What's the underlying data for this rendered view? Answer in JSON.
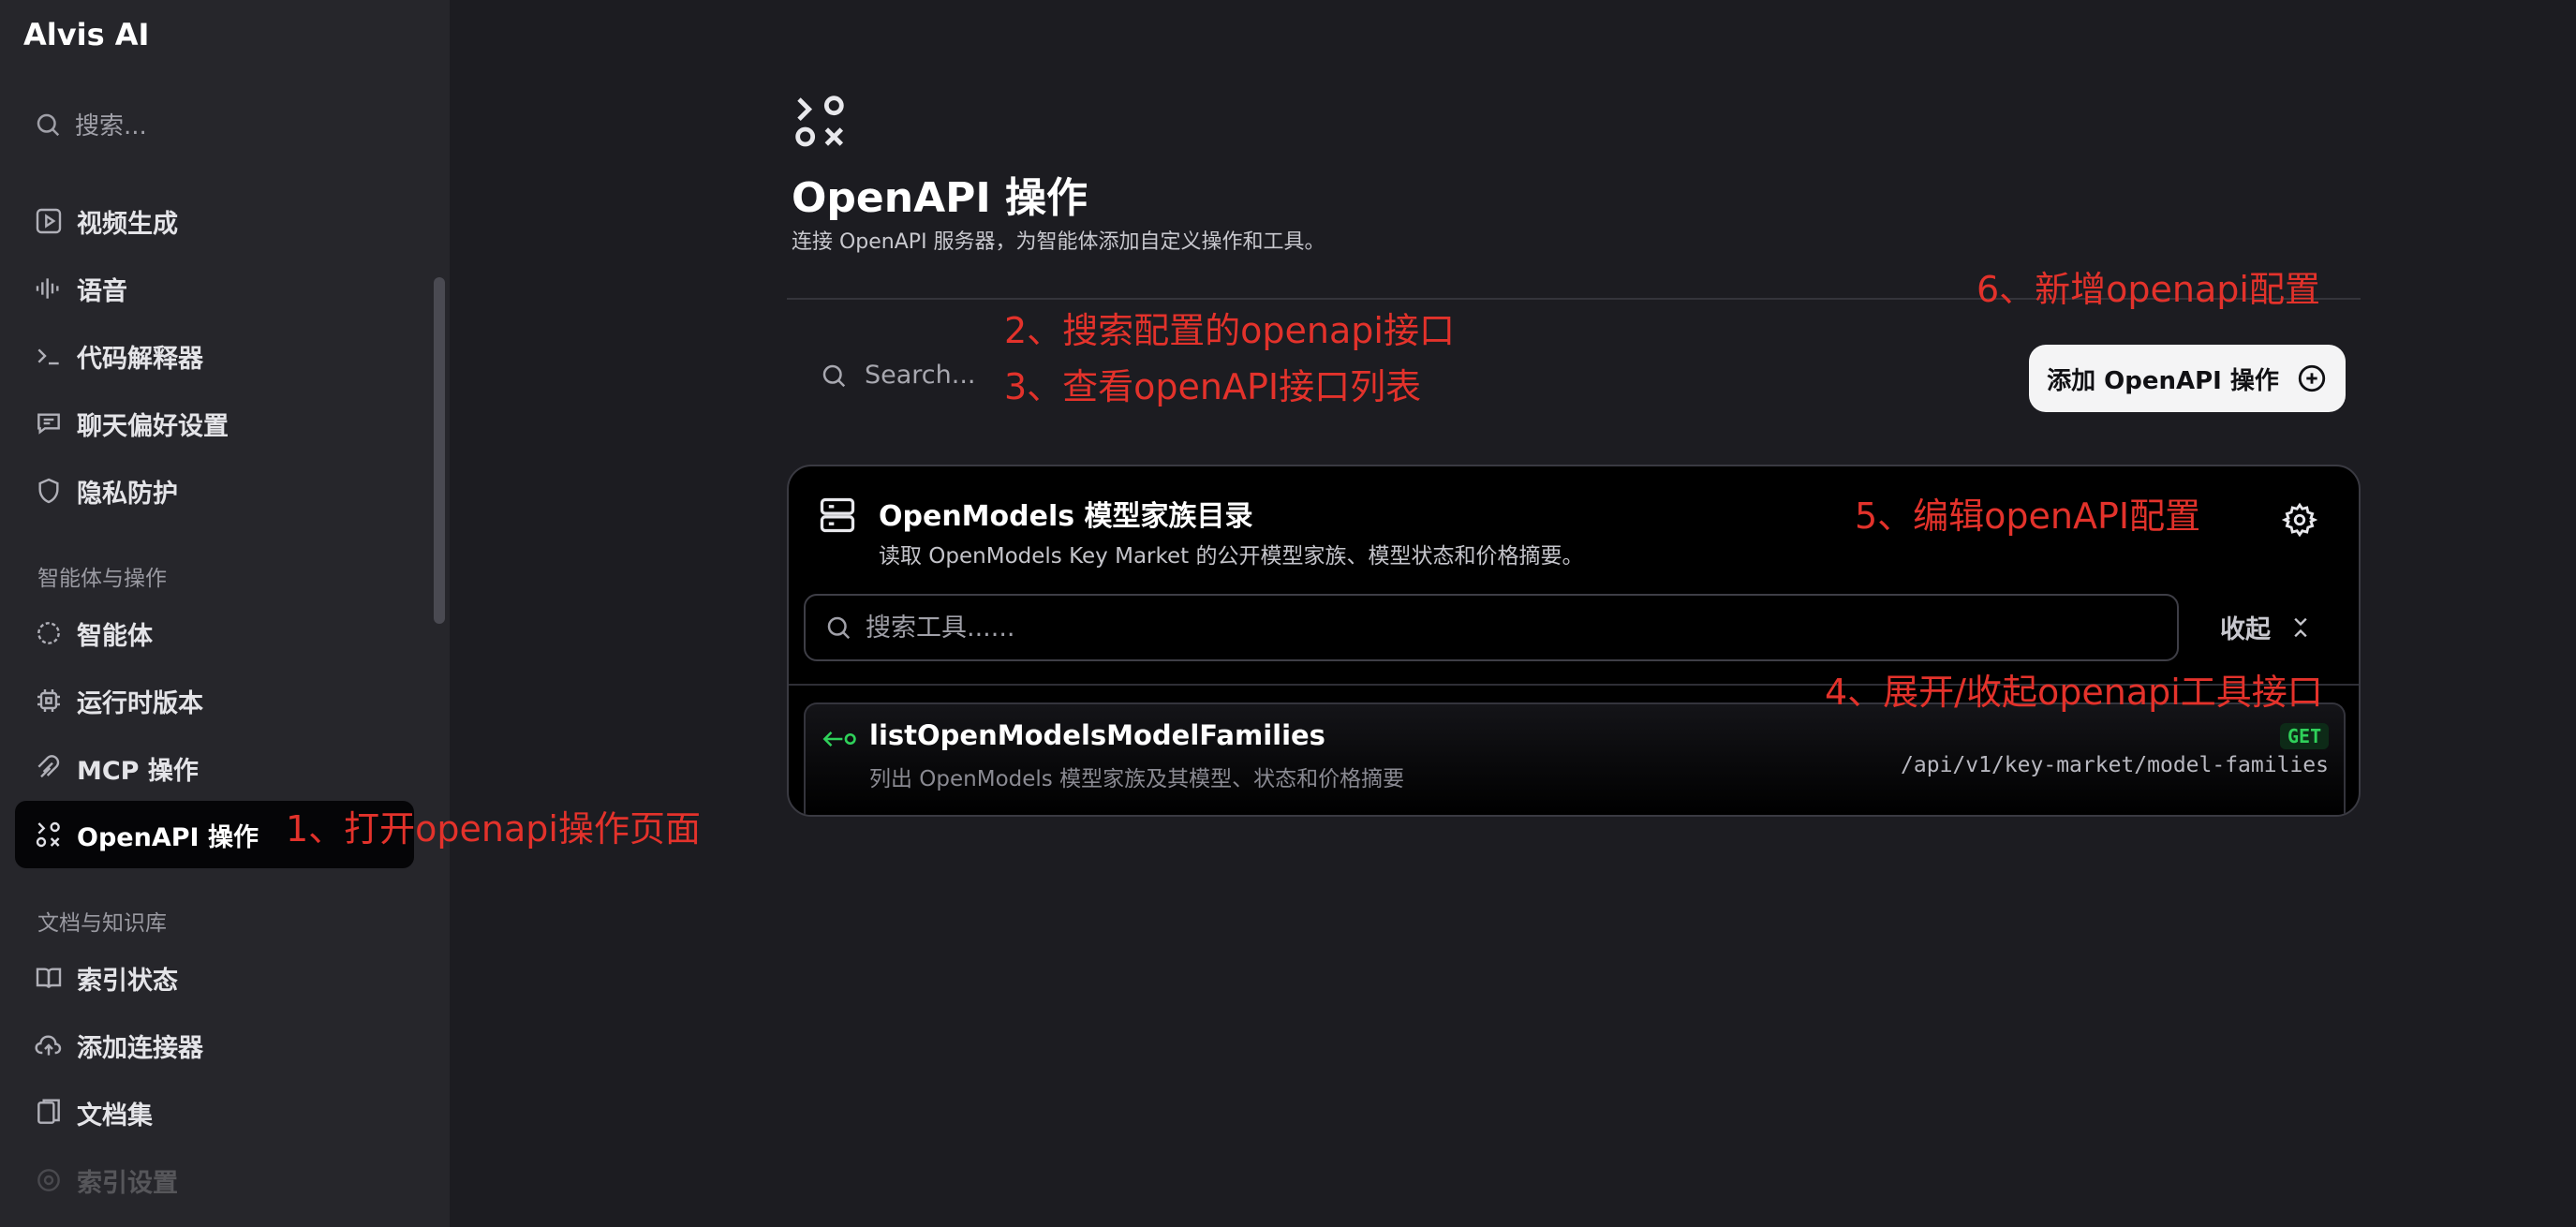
{
  "sidebar": {
    "brand": "Alvis AI",
    "search_placeholder": "搜索...",
    "items_top": [
      {
        "label": "视频生成",
        "icon": "video-play-icon"
      },
      {
        "label": "语音",
        "icon": "audio-wave-icon"
      },
      {
        "label": "代码解释器",
        "icon": "terminal-icon"
      },
      {
        "label": "聊天偏好设置",
        "icon": "chat-icon"
      },
      {
        "label": "隐私防护",
        "icon": "shield-icon"
      }
    ],
    "section_agents": "智能体与操作",
    "items_agents": [
      {
        "label": "智能体",
        "icon": "agent-circle-icon"
      },
      {
        "label": "运行时版本",
        "icon": "chip-icon"
      },
      {
        "label": "MCP 操作",
        "icon": "mcp-icon"
      },
      {
        "label": "OpenAPI 操作",
        "icon": "openapi-icon",
        "active": true
      }
    ],
    "section_docs": "文档与知识库",
    "items_docs": [
      {
        "label": "索引状态",
        "icon": "book-icon"
      },
      {
        "label": "添加连接器",
        "icon": "cloud-upload-icon"
      },
      {
        "label": "文档集",
        "icon": "documents-icon"
      },
      {
        "label": "索引设置",
        "icon": "settings-icon"
      }
    ]
  },
  "header": {
    "title": "OpenAPI 操作",
    "description": "连接 OpenAPI 服务器，为智能体添加自定义操作和工具。"
  },
  "toolbar": {
    "search_placeholder": "Search...",
    "add_button_label": "添加 OpenAPI 操作"
  },
  "card": {
    "title": "OpenModels 模型家族目录",
    "description": "读取 OpenModels Key Market 的公开模型家族、模型状态和价格摘要。",
    "tool_search_placeholder": "搜索工具......",
    "collapse_label": "收起",
    "endpoints": [
      {
        "name": "listOpenModelsModelFamilies",
        "description": "列出 OpenModels 模型家族及其模型、状态和价格摘要",
        "method": "GET",
        "path": "/api/v1/key-market/model-families"
      }
    ]
  },
  "annotations": {
    "a1": "1、打开openapi操作页面",
    "a2": "2、搜索配置的openapi接口",
    "a3": "3、查看openAPI接口列表",
    "a4": "4、展开/收起openapi工具接口",
    "a5": "5、编辑openAPI配置",
    "a6": "6、新增openapi配置"
  },
  "colors": {
    "annotation": "#e3322b",
    "method_get": "#2fd15a",
    "background": "#1c1c21",
    "sidebar": "#26262b"
  }
}
